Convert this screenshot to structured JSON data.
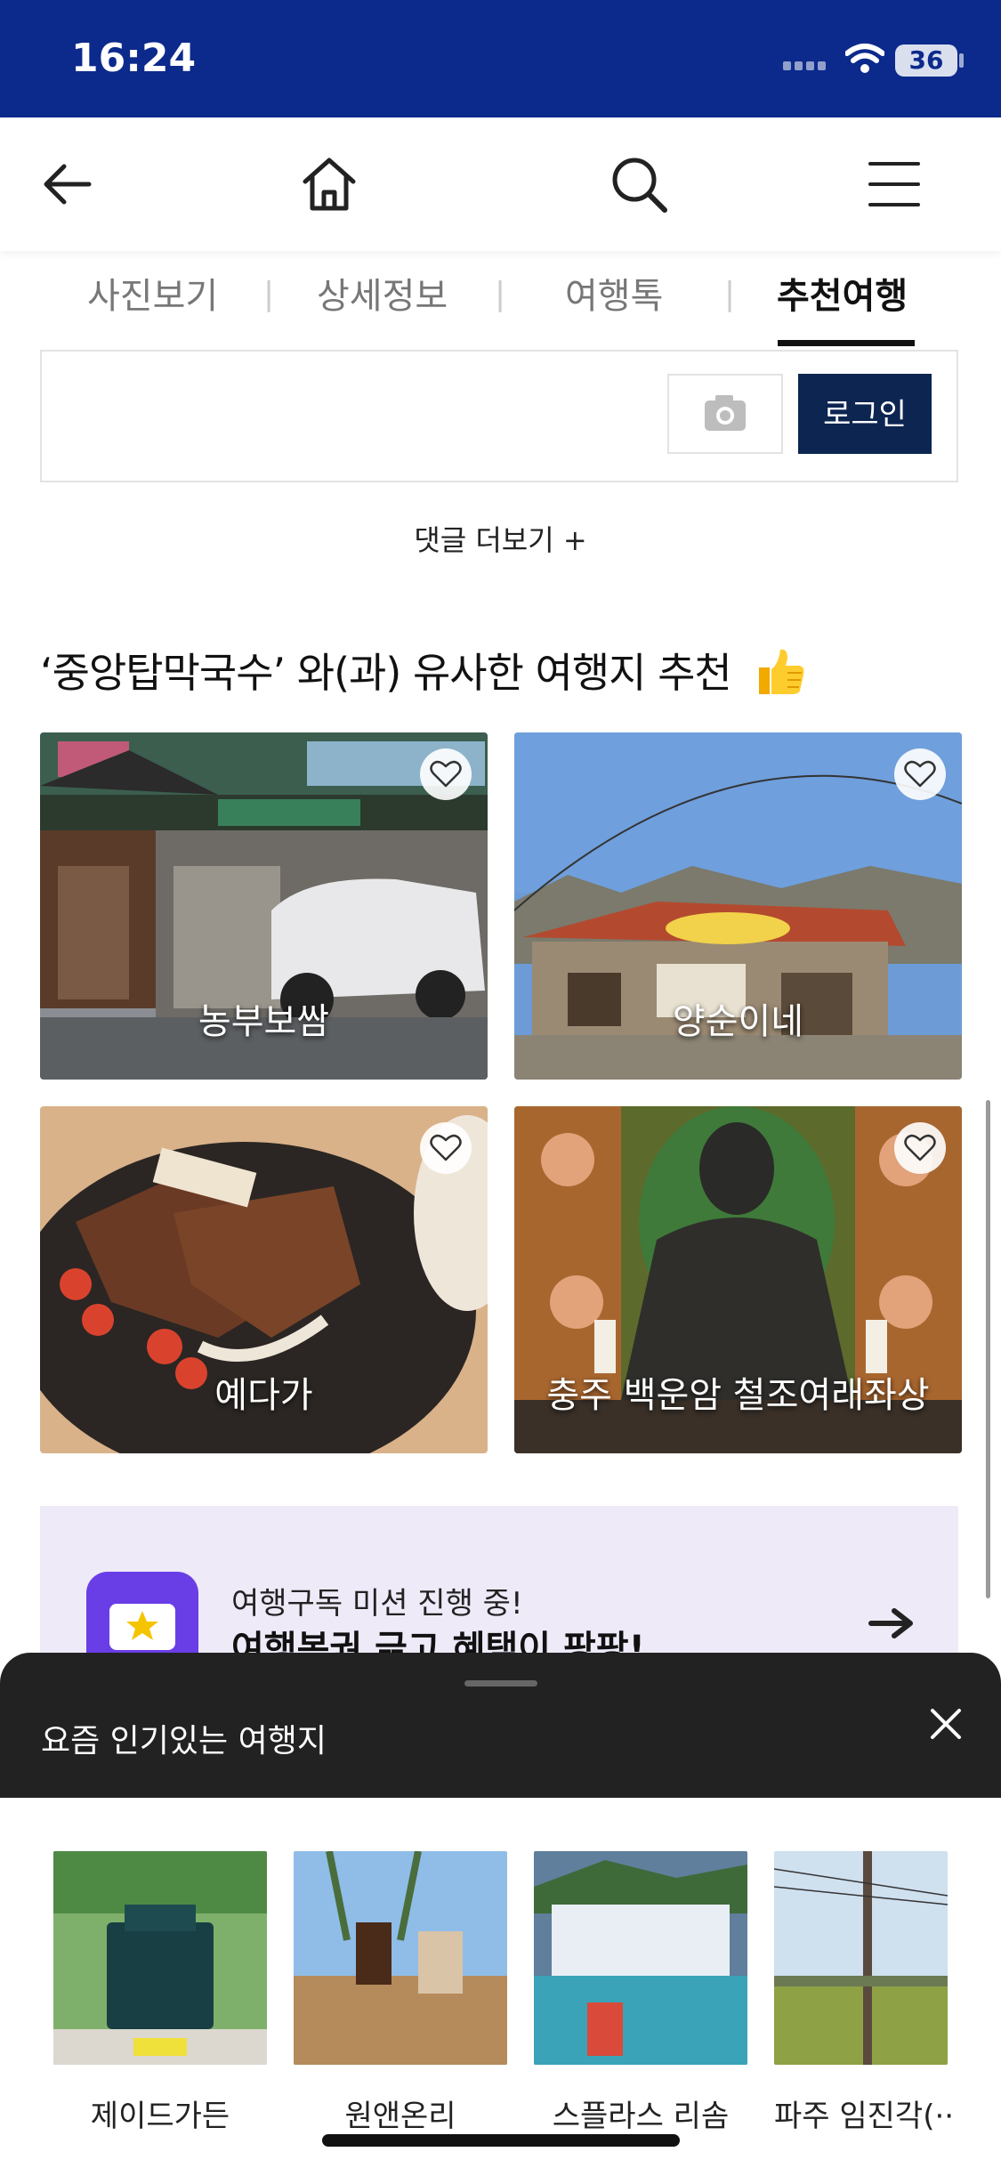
{
  "status_bar": {
    "time": "16:24",
    "battery": "36"
  },
  "tabs": [
    {
      "label": "사진보기"
    },
    {
      "label": "상세정보"
    },
    {
      "label": "여행톡"
    },
    {
      "label": "추천여행"
    }
  ],
  "tab_separator": "|",
  "comment": {
    "login_label": "로그인",
    "more_label": "댓글 더보기 +"
  },
  "section": {
    "title": "‘중앙탑막국수’ 와(과) 유사한 여행지 추천",
    "cards": [
      {
        "label": "농부보쌈"
      },
      {
        "label": "양순이네"
      },
      {
        "label": "예다가"
      },
      {
        "label": "충주 백운암 철조여래좌상"
      }
    ]
  },
  "banner": {
    "line1": "여행구독 미션 진행 중!",
    "line2": "여행복권 긁고 혜택이 팡팡!"
  },
  "popular_sheet": {
    "title": "요즘 인기있는 여행지",
    "items": [
      {
        "label": "제이드가든"
      },
      {
        "label": "원앤온리"
      },
      {
        "label": "스플라스 리솜"
      },
      {
        "label": "파주 임진각(··"
      }
    ]
  },
  "colors": {
    "status_bar": "#0c2a8c",
    "login_button": "#0d2551",
    "sheet_header": "#222222",
    "banner_bg": "#eeeaf8"
  }
}
